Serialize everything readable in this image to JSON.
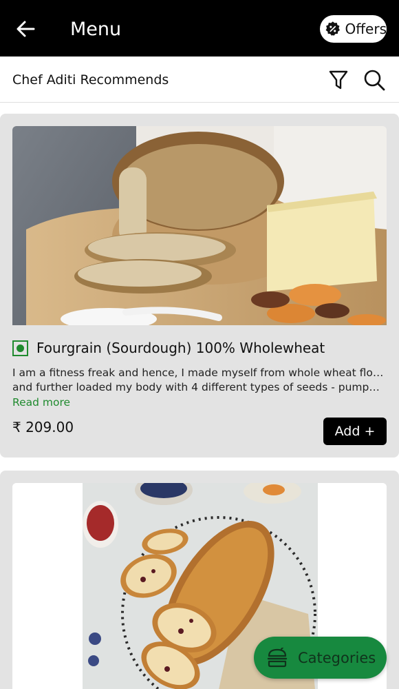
{
  "header": {
    "title": "Menu",
    "offers_label": "Offers",
    "back_icon": "arrow-left-icon",
    "offers_icon": "discount-badge-icon"
  },
  "subheader": {
    "title": "Chef Aditi Recommends",
    "filter_icon": "filter-icon",
    "search_icon": "search-icon"
  },
  "items": [
    {
      "name": "Fourgrain (Sourdough) 100% Wholewheat",
      "description_line1": "I am a fitness freak and hence, I made myself from whole wheat flour",
      "description_line2": "and further loaded my body with 4 different types of seeds - pumpkin, s...",
      "read_more": "Read more",
      "price": "₹ 209.00",
      "add_label": "Add +",
      "veg": true
    },
    {
      "image": "cranberry-bread-photo"
    }
  ],
  "fab": {
    "label": "Categories",
    "icon": "burger-icon"
  },
  "colors": {
    "header_bg": "#000000",
    "accent_green": "#1f8a2e",
    "fab_bg": "#17893f",
    "card_bg": "#e3e3e3"
  }
}
